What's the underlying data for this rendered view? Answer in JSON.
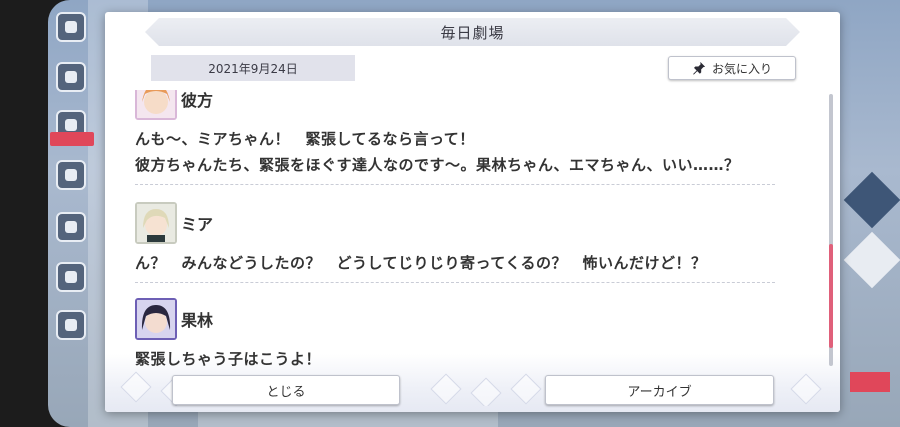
{
  "dialog": {
    "title": "毎日劇場",
    "date": "2021年9月24日",
    "favorite_label": "お気に入り"
  },
  "entries": [
    {
      "speaker": "彼方",
      "lines": [
        "んも〜、ミアちゃん！　緊張してるなら言って！",
        "彼方ちゃんたち、緊張をほぐす達人なのです〜。果林ちゃん、エマちゃん、いい……？"
      ]
    },
    {
      "speaker": "ミア",
      "lines": [
        "ん？　みんなどうしたの？　どうしてじりじり寄ってくるの？　怖いんだけど！？"
      ]
    },
    {
      "speaker": "果林",
      "lines": [
        "緊張しちゃう子はこうよ！"
      ]
    }
  ],
  "buttons": {
    "close_label": "とじる",
    "archive_label": "アーカイブ"
  },
  "scroll": {
    "position_fraction": 0.55
  },
  "icons": {
    "favorite": "pin-icon",
    "speaker1": "kanata-avatar",
    "speaker2": "mia-avatar",
    "speaker3": "karin-avatar"
  },
  "colors": {
    "scroll_thumb": "#e0607a",
    "accent_red": "#e0475a"
  }
}
